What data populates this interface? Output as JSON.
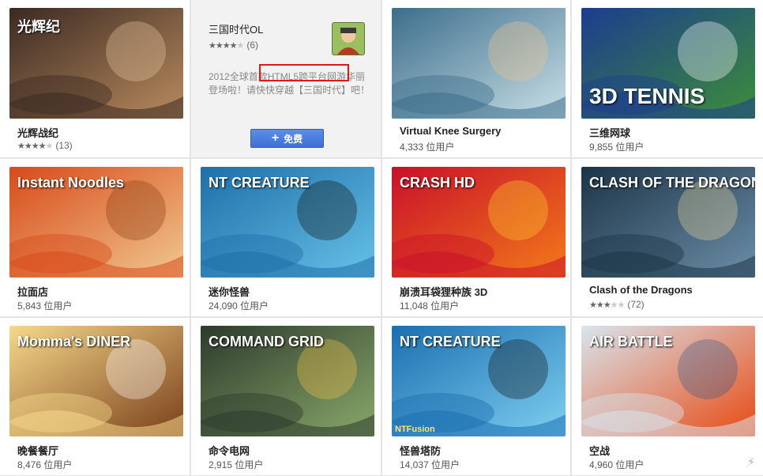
{
  "apps": [
    {
      "id": "a1",
      "title": "光辉战纪",
      "rating": 4,
      "rating_count": "(13)",
      "thumb_text": "光辉纪",
      "colors": [
        "#3b2a22",
        "#b98b5e",
        "#e8c9a0"
      ]
    },
    {
      "id": "a2",
      "detail": true,
      "title": "三国时代OL",
      "rating": 4,
      "rating_count": "(6)",
      "description": "2012全球首款HTML5跨平台网游华丽登场啦！请快快穿越【三国时代】吧！",
      "button_label": "免费",
      "button_icon": "plus-icon"
    },
    {
      "id": "a3",
      "title": "Virtual Knee Surgery",
      "users": "4,333 位用户",
      "colors": [
        "#3d6e8c",
        "#c9e0e6",
        "#f1c48c"
      ]
    },
    {
      "id": "a4",
      "title": "三维网球",
      "users": "9,855 位用户",
      "thumb_text": "3D TENNIS",
      "colors": [
        "#1d3c8f",
        "#3c8e3a",
        "#ffffff"
      ]
    },
    {
      "id": "a5",
      "title": "拉面店",
      "users": "5,843 位用户",
      "thumb_text": "Instant Noodles",
      "colors": [
        "#d84a1a",
        "#f0c890",
        "#8a3b12"
      ]
    },
    {
      "id": "a6",
      "title": "迷你怪兽",
      "users": "24,090 位用户",
      "thumb_text": "NT CREATURE",
      "colors": [
        "#1e6fa8",
        "#66c2e8",
        "#111111"
      ]
    },
    {
      "id": "a7",
      "title": "崩溃耳袋狸种族 3D",
      "users": "11,048 位用户",
      "thumb_text": "CRASH HD",
      "colors": [
        "#c9102a",
        "#f27a1a",
        "#ffcf2e"
      ]
    },
    {
      "id": "a8",
      "title": "Clash of the Dragons",
      "rating": 3,
      "rating_count": "(72)",
      "thumb_text": "CLASH OF THE DRAGONS",
      "colors": [
        "#1c3447",
        "#6c8ea8",
        "#e8d39a"
      ]
    },
    {
      "id": "a9",
      "title": "晚餐餐厅",
      "users": "8,476 位用户",
      "thumb_text": "Momma's DINER",
      "colors": [
        "#f5d88a",
        "#7a3f1a",
        "#ffffff"
      ]
    },
    {
      "id": "a10",
      "title": "命令电网",
      "users": "2,915 位用户",
      "thumb_text": "COMMAND GRID",
      "colors": [
        "#2c3b2c",
        "#8aa86a",
        "#f5c24a"
      ]
    },
    {
      "id": "a11",
      "title": "怪兽塔防",
      "users": "14,037 位用户",
      "thumb_text": "NT CREATURE",
      "badge": "NTFusion",
      "colors": [
        "#1a6fb0",
        "#7fcff0",
        "#111111"
      ]
    },
    {
      "id": "a12",
      "title": "空战",
      "users": "4,960 位用户",
      "thumb_text": "AIR BATTLE",
      "colors": [
        "#d8e4ee",
        "#e84a12",
        "#3a5a8a"
      ]
    }
  ]
}
